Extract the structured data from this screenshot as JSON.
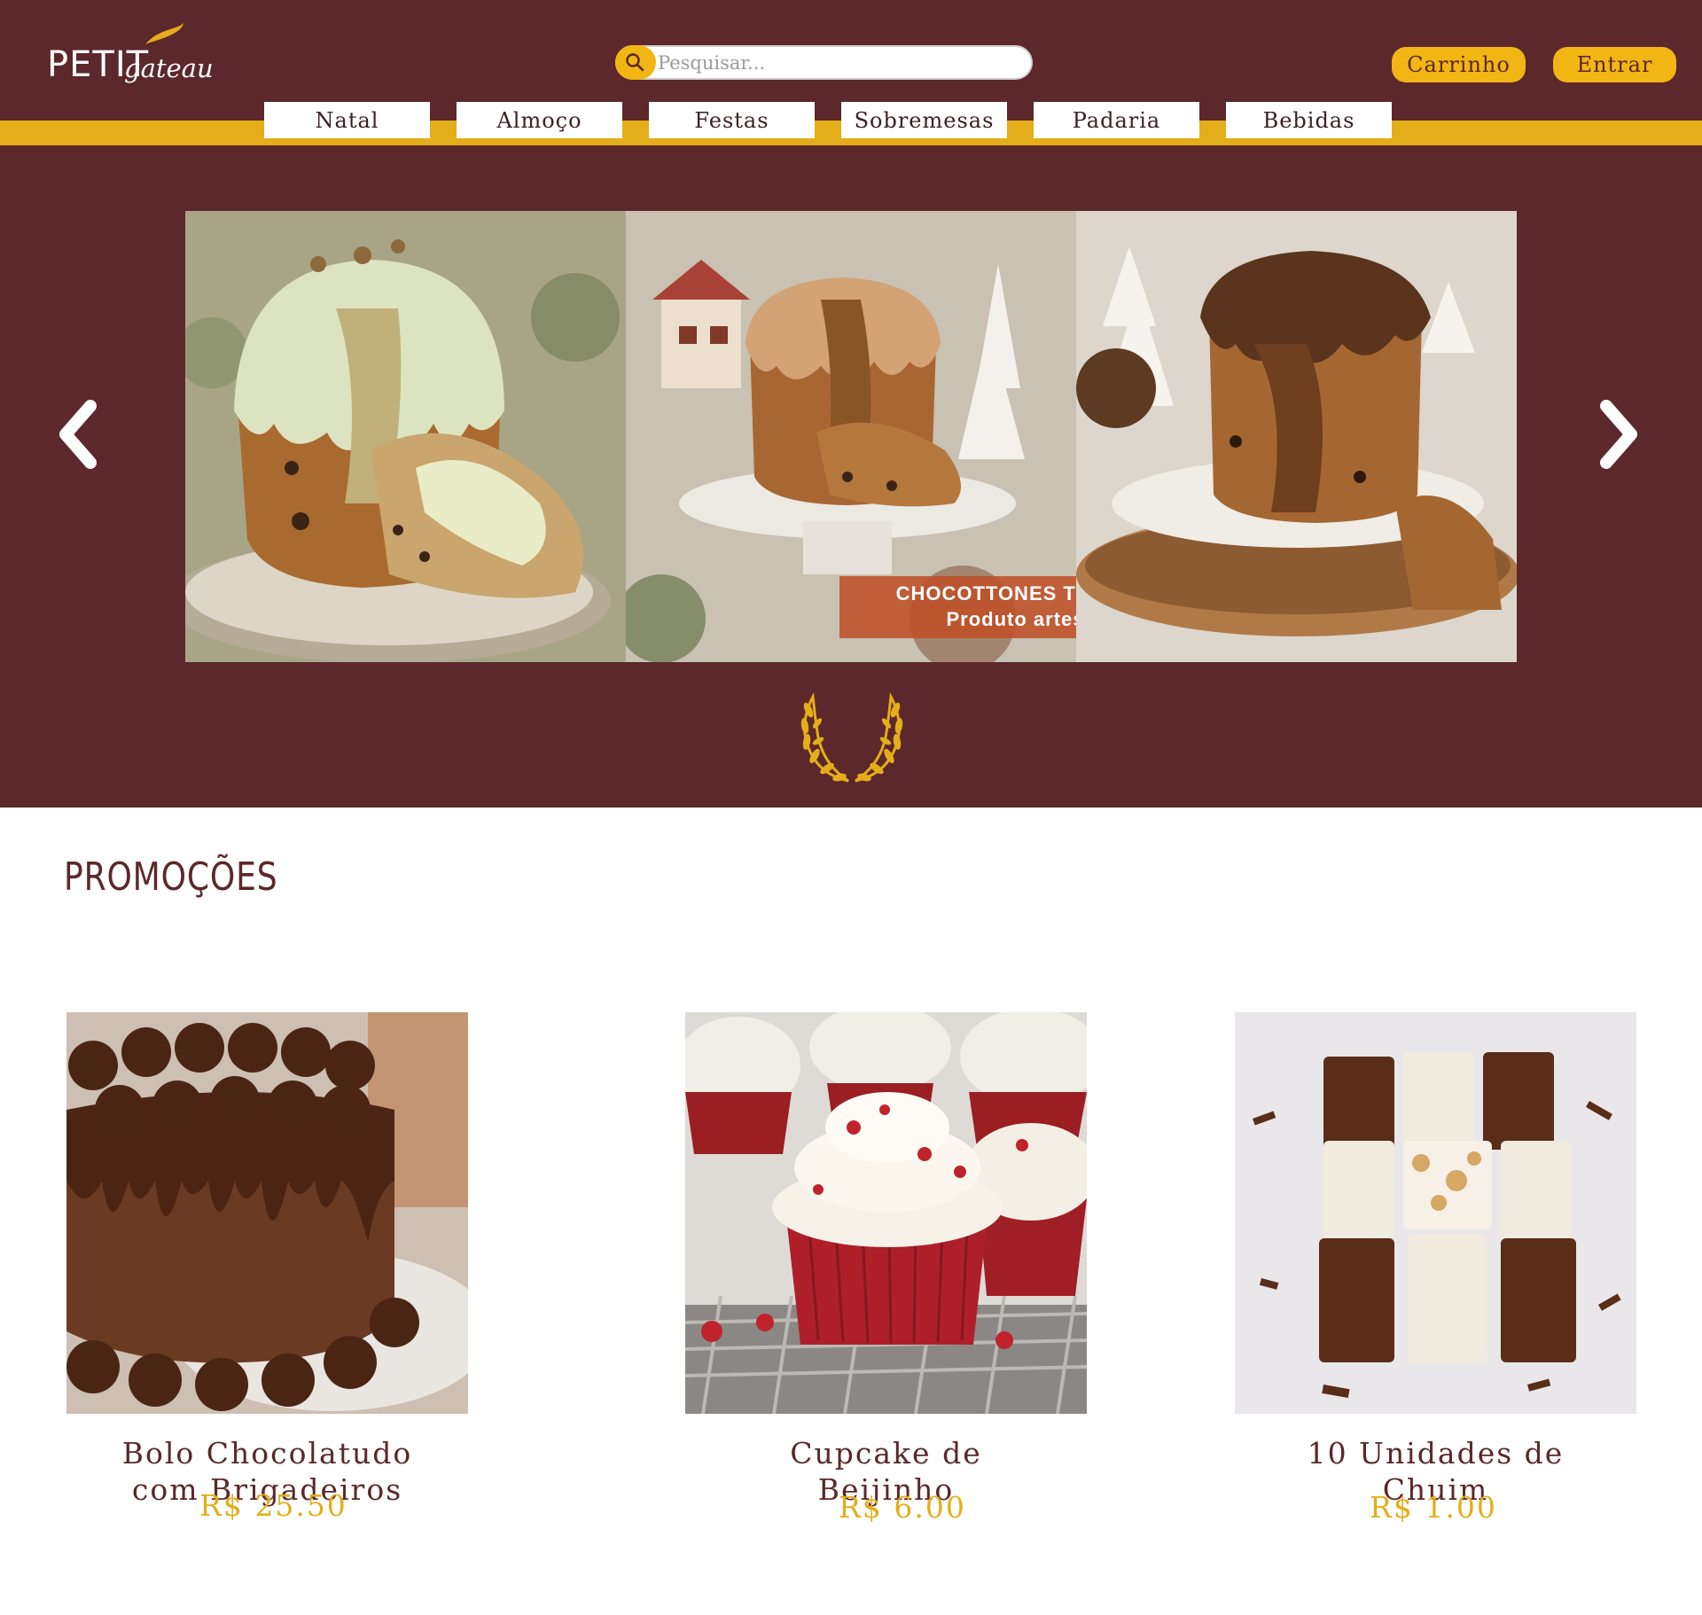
{
  "brand": {
    "name_main": "PETIT",
    "name_sub": "gateau"
  },
  "search": {
    "placeholder": "Pesquisar..."
  },
  "header_buttons": {
    "cart": "Carrinho",
    "login": "Entrar"
  },
  "categories": [
    "Natal",
    "Almoço",
    "Festas",
    "Sobremesas",
    "Padaria",
    "Bebidas"
  ],
  "carousel": {
    "banner_title": "CHOCOTTONES TRUFADOS",
    "banner_subtitle": "Produto artesanal"
  },
  "promotions": {
    "title": "PROMOÇÕES",
    "items": [
      {
        "name_line1": "Bolo Chocolatudo",
        "name_line2": "com Brigadeiros",
        "price": "R$ 25.50"
      },
      {
        "name_line1": "Cupcake de",
        "name_line2": "Beijinho",
        "price": "R$ 6.00"
      },
      {
        "name_line1": "10 Unidades de",
        "name_line2": "Chuim",
        "price": "R$ 1.00"
      }
    ]
  },
  "colors": {
    "maroon": "#5c282b",
    "gold": "#e3ae19",
    "white": "#ffffff"
  }
}
